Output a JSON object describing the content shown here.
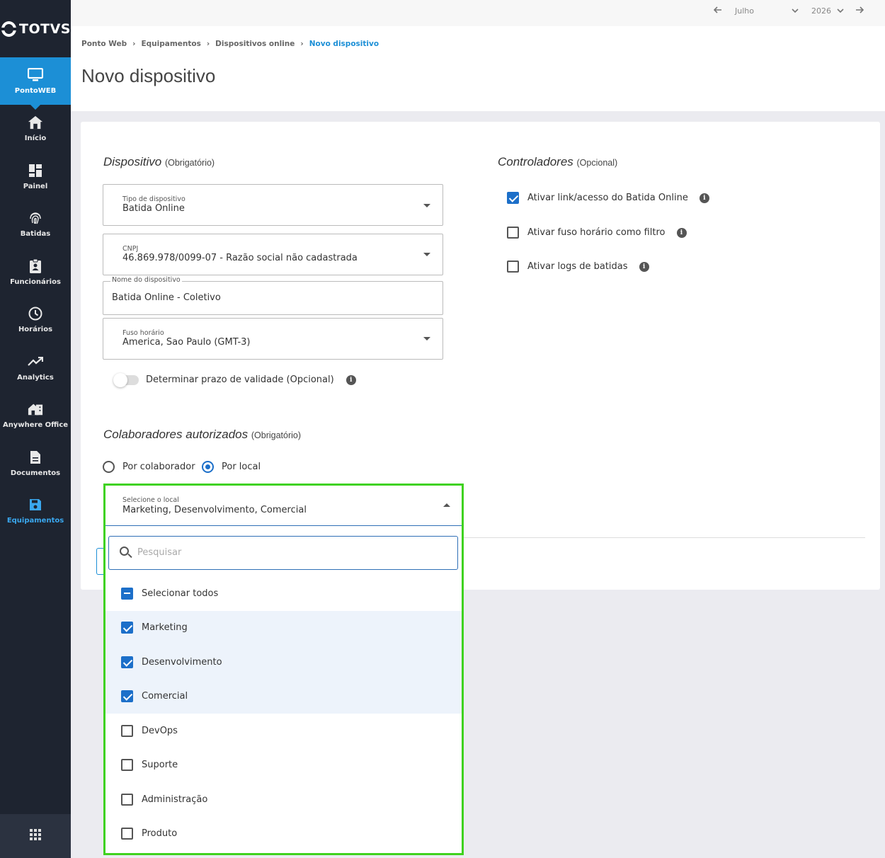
{
  "brand": {
    "logo": "TOTVS"
  },
  "topbar": {
    "month": "Julho",
    "year": "2026"
  },
  "sidebar": {
    "items": [
      {
        "label": "PontoWEB",
        "icon": "monitor-icon"
      },
      {
        "label": "Início",
        "icon": "home-icon"
      },
      {
        "label": "Painel",
        "icon": "dashboard-icon"
      },
      {
        "label": "Batidas",
        "icon": "fingerprint-icon"
      },
      {
        "label": "Funcionários",
        "icon": "badge-icon"
      },
      {
        "label": "Horários",
        "icon": "clock-icon"
      },
      {
        "label": "Analytics",
        "icon": "trending-up-icon"
      },
      {
        "label": "Anywhere Office",
        "icon": "house-work-icon"
      },
      {
        "label": "Documentos",
        "icon": "document-icon"
      },
      {
        "label": "Equipamentos",
        "icon": "save-icon"
      }
    ]
  },
  "breadcrumb": [
    "Ponto Web",
    "Equipamentos",
    "Dispositivos online",
    "Novo dispositivo"
  ],
  "page": {
    "title": "Novo dispositivo"
  },
  "dispositivo": {
    "title": "Dispositivo",
    "note": "(Obrigatório)",
    "tipo": {
      "label": "Tipo de dispositivo",
      "value": "Batida Online"
    },
    "cnpj": {
      "label": "CNPJ",
      "value": "46.869.978/0099-07 - Razão social não cadastrada"
    },
    "nome": {
      "label": "Nome do dispositivo",
      "value": "Batida Online - Coletivo"
    },
    "fuso": {
      "label": "Fuso horário",
      "value": "America, Sao Paulo (GMT-3)"
    },
    "validade": {
      "label": "Determinar prazo de validade (Opcional)",
      "enabled": false
    }
  },
  "controladores": {
    "title": "Controladores",
    "note": "(Opcional)",
    "options": [
      {
        "label": "Ativar link/acesso do Batida Online",
        "checked": true
      },
      {
        "label": "Ativar fuso horário como filtro",
        "checked": false
      },
      {
        "label": "Ativar logs de batidas",
        "checked": false
      }
    ]
  },
  "colaboradores": {
    "title": "Colaboradores autorizados",
    "note": "(Obrigatório)",
    "radio": [
      {
        "label": "Por colaborador",
        "selected": false
      },
      {
        "label": "Por local",
        "selected": true
      }
    ],
    "local": {
      "label": "Selecione o local",
      "value": "Marketing, Desenvolvimento, Comercial",
      "search_placeholder": "Pesquisar",
      "select_all": "Selecionar todos",
      "options": [
        {
          "label": "Marketing",
          "checked": true
        },
        {
          "label": "Desenvolvimento",
          "checked": true
        },
        {
          "label": "Comercial",
          "checked": true
        },
        {
          "label": "DevOps",
          "checked": false
        },
        {
          "label": "Suporte",
          "checked": false
        },
        {
          "label": "Administração",
          "checked": false
        },
        {
          "label": "Produto",
          "checked": false
        }
      ]
    }
  },
  "colors": {
    "accent": "#1c8fd6",
    "sidebar": "#1e2430",
    "highlight": "#3fd21e",
    "check": "#1c6fc9"
  }
}
